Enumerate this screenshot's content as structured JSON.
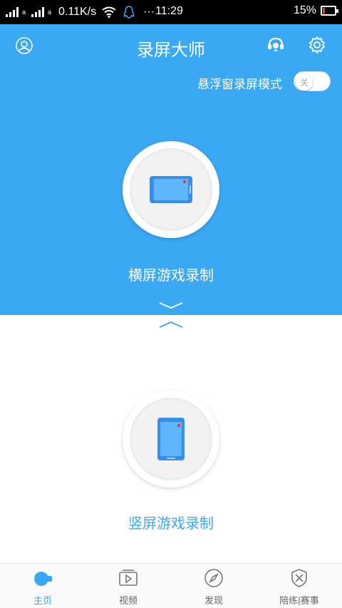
{
  "status_bar": {
    "signal_sub": "a",
    "signal_sub_2": "a",
    "network_speed": "0.11K/s",
    "more_dots": "···",
    "time": "11:29",
    "battery_percent": "15%"
  },
  "header": {
    "title": "录屏大师",
    "float_mode_label": "悬浮窗录屏模式",
    "float_toggle_label": "关"
  },
  "landscape": {
    "label": "横屏游戏录制"
  },
  "portrait": {
    "label": "竖屏游戏录制"
  },
  "colors": {
    "primary": "#3aa8f2",
    "red_dot": "#e53935"
  },
  "nav": {
    "home": "主页",
    "video": "视频",
    "discover": "发现",
    "practice": "陪练|赛事"
  }
}
